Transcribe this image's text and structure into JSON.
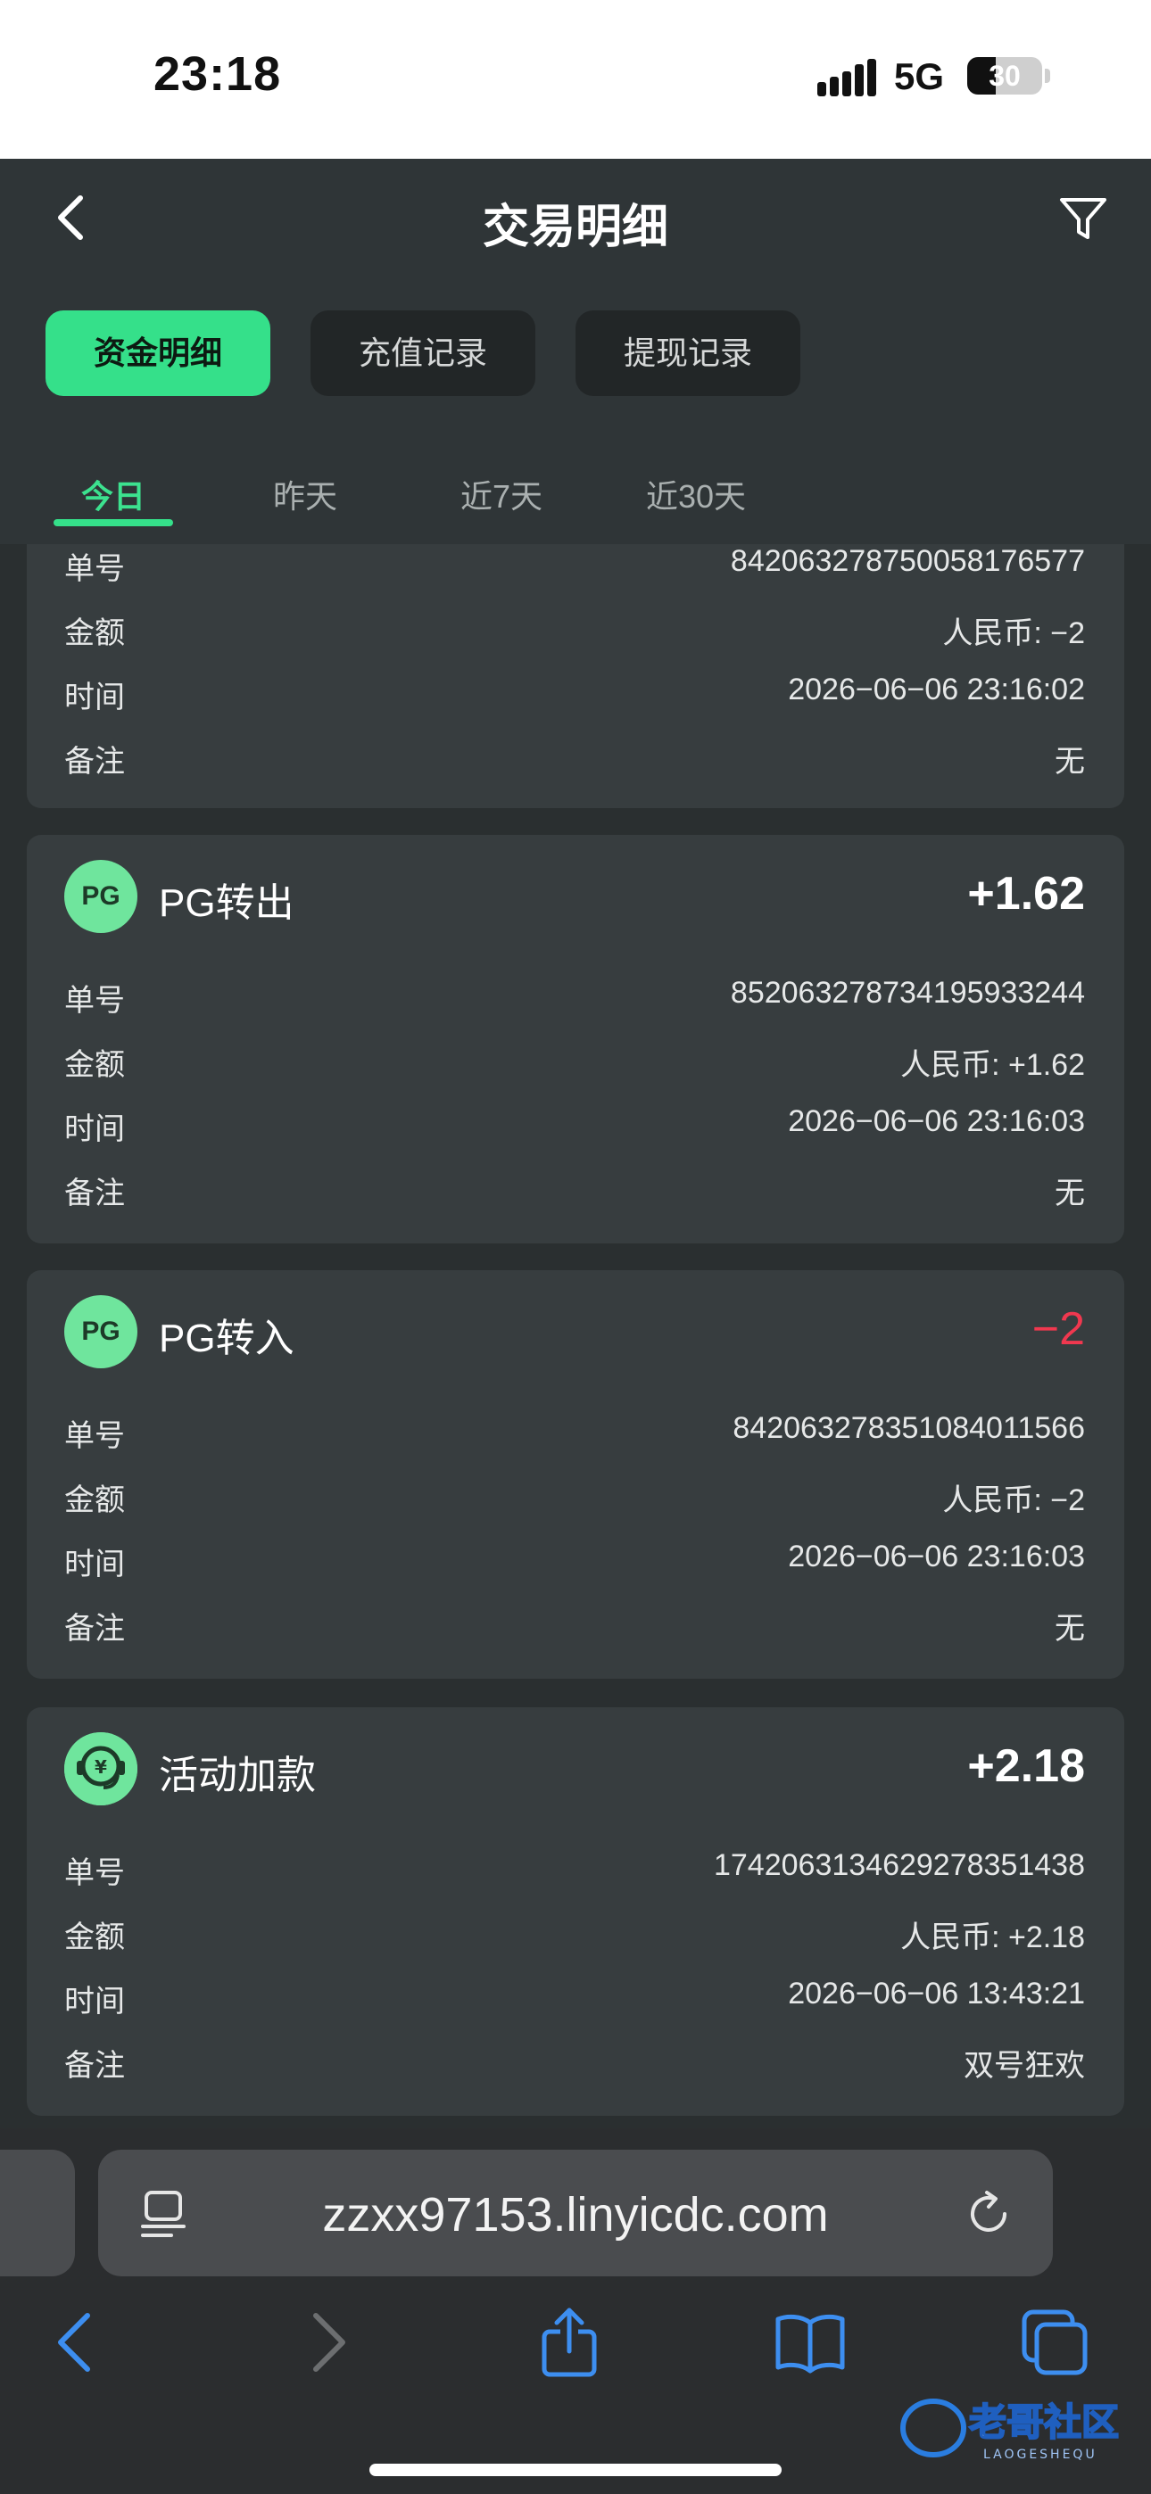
{
  "status_bar": {
    "time": "23:18",
    "network": "5G",
    "battery": "30"
  },
  "header": {
    "title": "交易明细",
    "segments": [
      {
        "label": "资金明细",
        "active": true
      },
      {
        "label": "充值记录",
        "active": false
      },
      {
        "label": "提现记录",
        "active": false
      }
    ],
    "date_tabs": [
      {
        "label": "今日",
        "active": true
      },
      {
        "label": "昨天",
        "active": false
      },
      {
        "label": "近7天",
        "active": false
      },
      {
        "label": "近30天",
        "active": false
      }
    ]
  },
  "field_labels": {
    "order": "单号",
    "amount": "金额",
    "time": "时间",
    "note": "备注"
  },
  "partial_card": {
    "order": "842063278750058176577",
    "amount": "人民币: −2",
    "time": "2026−06−06 23:16:02",
    "note": "无"
  },
  "cards": [
    {
      "icon": "pg-icon",
      "icon_text": "PG",
      "title": "PG转出",
      "amount": "+1.62",
      "sign": "pos",
      "order": "852063278734195933244",
      "amount_detail": "人民币: +1.62",
      "time": "2026−06−06 23:16:03",
      "note": "无"
    },
    {
      "icon": "pg-icon",
      "icon_text": "PG",
      "title": "PG转入",
      "amount": "−2",
      "sign": "neg",
      "order": "842063278351084011566",
      "amount_detail": "人民币: −2",
      "time": "2026−06−06 23:16:03",
      "note": "无"
    },
    {
      "icon": "activity-bonus-icon",
      "icon_text": "",
      "title": "活动加款",
      "amount": "+2.18",
      "sign": "pos",
      "order": "174206313462927835143​8",
      "amount_detail": "人民币: +2.18",
      "time": "2026−06−06 13:43:21",
      "note": "双号狂欢"
    }
  ],
  "browser": {
    "url": "zzxx97153.linyicdc.com"
  },
  "watermark": {
    "main": "老哥社区",
    "sub": "LAOGESHEQU"
  },
  "colors": {
    "accent": "#35e08a",
    "negative": "#f0384f",
    "card_bg": "#373d3f"
  }
}
